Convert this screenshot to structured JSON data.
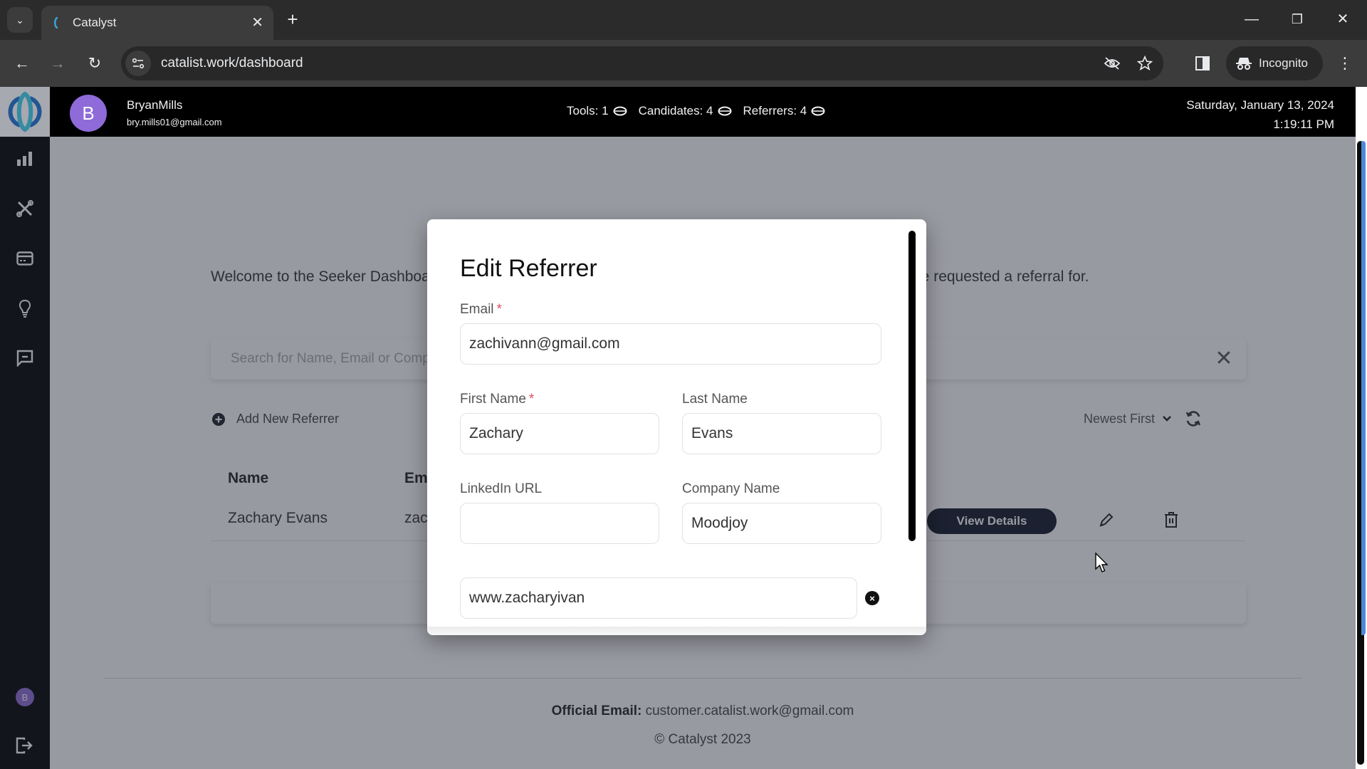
{
  "browser": {
    "tab_title": "Catalyst",
    "url": "catalist.work/dashboard",
    "incognito_label": "Incognito",
    "new_tab_glyph": "+",
    "tab_close_glyph": "✕",
    "minimize_glyph": "—",
    "restore_glyph": "❐",
    "close_glyph": "✕",
    "back_glyph": "←",
    "forward_glyph": "→",
    "reload_glyph": "↻",
    "menu_glyph": "⋮",
    "tab_list_glyph": "⌄"
  },
  "header": {
    "avatar_letter": "B",
    "user_name": "BryanMills",
    "user_email": "bry.mills01@gmail.com",
    "stats": [
      {
        "label": "Tools: 1"
      },
      {
        "label": "Candidates: 4"
      },
      {
        "label": "Referrers: 4"
      }
    ],
    "date": "Saturday, January 13, 2024",
    "time": "1:19:11 PM"
  },
  "sidebar": {
    "items": [
      {
        "name": "dashboard",
        "icon": "bar-chart-icon"
      },
      {
        "name": "tools",
        "icon": "tools-icon"
      },
      {
        "name": "payments",
        "icon": "credit-card-icon"
      },
      {
        "name": "ideas",
        "icon": "lightbulb-icon"
      },
      {
        "name": "messages",
        "icon": "message-icon"
      }
    ],
    "avatar_letter": "B",
    "logout_icon": "logout-icon"
  },
  "main": {
    "welcome_text": "Welcome to the Seeker Dashboard! Here you can see the list of referrers you have added and jobs you have requested a referral for.",
    "search_placeholder": "Search for Name, Email or Company",
    "search_clear_glyph": "✕",
    "add_referrer_label": "Add New Referrer",
    "sort_selected": "Newest First",
    "table": {
      "columns": [
        "Name",
        "Email"
      ],
      "rows": [
        {
          "name": "Zachary Evans",
          "email": "zachivann@gmail.com",
          "action_label": "View Details"
        }
      ]
    }
  },
  "footer": {
    "official_email_label": "Official Email:",
    "official_email": "customer.catalist.work@gmail.com",
    "copyright": "© Catalyst 2023"
  },
  "modal": {
    "title": "Edit Referrer",
    "fields": {
      "email": {
        "label": "Email",
        "required": "*",
        "value": "zachivann@gmail.com"
      },
      "first_name": {
        "label": "First Name",
        "required": "*",
        "value": "Zachary"
      },
      "last_name": {
        "label": "Last Name",
        "value": "Evans"
      },
      "linkedin": {
        "label": "LinkedIn URL",
        "value": ""
      },
      "company": {
        "label": "Company Name",
        "value": "Moodjoy"
      },
      "link": {
        "value": "www.zacharyivan"
      }
    },
    "remove_glyph": "×"
  },
  "colors": {
    "accent_purple": "#8e6bd8",
    "required_red": "#e05260",
    "scroll_blue": "#4a8ad8",
    "button_dark": "#111827"
  }
}
